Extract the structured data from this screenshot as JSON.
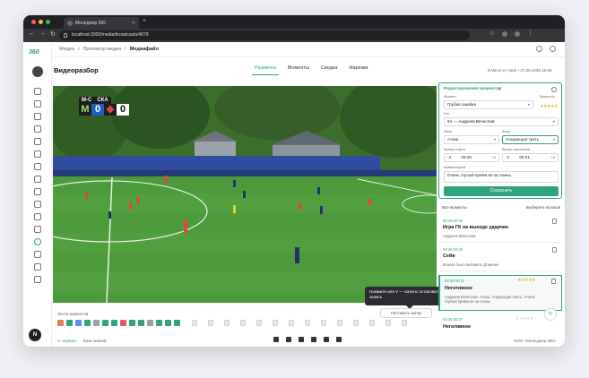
{
  "browser": {
    "tab_title": "Менеджер 360",
    "url": "localhost:3000/media/broadcasts/4678"
  },
  "sidebar": {
    "logo": "360",
    "user_initial": "N"
  },
  "breadcrumb": [
    "Медиа",
    "Просмотр медиа",
    "Медиафайл"
  ],
  "page": {
    "title": "Видеоразбор",
    "match_info": "КАМАЗ vs Урал • 27.06.2025 15:06"
  },
  "tabs": [
    {
      "label": "Разметка",
      "active": true
    },
    {
      "label": "Моменты",
      "active": false
    },
    {
      "label": "Сводка",
      "active": false
    },
    {
      "label": "Нарезки",
      "active": false
    }
  ],
  "video": {
    "team_home": "M-C",
    "team_away": "СКА",
    "score_home": "0",
    "score_away": "0"
  },
  "timeline": {
    "label": "Лента моментов",
    "add_button": "Поставить метку",
    "tooltip": "Нажмите или V — начать/ остановить запись",
    "chip_colors": [
      "#e57a5a",
      "#2ea37d",
      "#5b8def",
      "#2ea37d",
      "#9aa0a6",
      "#2ea37d",
      "#2ea37d",
      "#e55a5a",
      "#2ea37d",
      "#2ea37d",
      "#9aa0a6",
      "#2ea37d",
      "#2ea37d",
      "#2ea37d"
    ]
  },
  "panel": {
    "header": "Редактирование момента",
    "moment_label": "Момент",
    "moment_value": "Грубая ошибка",
    "importance_label": "Важность",
    "rating": "★★★★★",
    "who_label": "Кто",
    "who_value": "64 — Андреев Вячеслав",
    "phase_label": "Фаза",
    "phase_value": "Атака",
    "zone_label": "Зона",
    "zone_value": "Атакующая треть",
    "start_label": "Время старта",
    "start_value": "00:28",
    "end_label": "Время окончания",
    "end_value": "00:31",
    "step_minus_start": "-4",
    "step_plus_start": "+4",
    "step_minus_end": "-4",
    "step_plus_end": "+4",
    "comment_label": "Комментарий",
    "comment_value": "Очень глупый приём из-за спины",
    "save_button": "Сохранить"
  },
  "filters": {
    "left": "Все моменты",
    "right": "Выберите игроков"
  },
  "moments": [
    {
      "time": "00:26:00:20",
      "name": "Игра ГК на выходе ударчик",
      "desc": "Андреев Вячеслав"
    },
    {
      "time": "00:26:00:30",
      "name": "Сейв",
      "desc": "Можно было выбивать Длиннее"
    },
    {
      "time": "00:28:00:31",
      "name": "Негативное",
      "desc": "Андреев Вячеслав. Атака. Атакующая треть. Очень глупый приём из-за спины"
    },
    {
      "time": "00:30:00:47",
      "name": "Негативное",
      "desc": ""
    }
  ],
  "footer": {
    "left_link1": "О сервисе",
    "left_link2": "База знаний",
    "right": "ООО «Менеджер 360»"
  }
}
